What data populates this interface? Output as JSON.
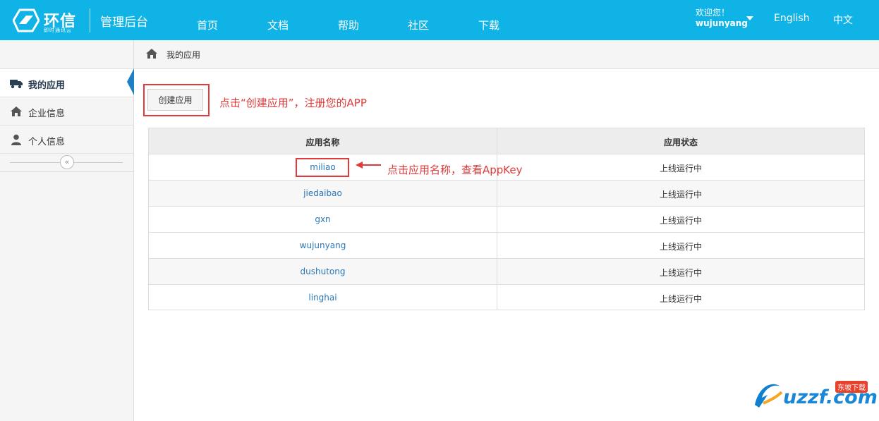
{
  "brand": {
    "name": "环信",
    "sub": "即时通讯云",
    "admin_title": "管理后台"
  },
  "nav": [
    {
      "label": "首页"
    },
    {
      "label": "文档"
    },
    {
      "label": "帮助"
    },
    {
      "label": "社区"
    },
    {
      "label": "下载"
    }
  ],
  "user": {
    "greeting": "欢迎您！",
    "name": "wujunyang"
  },
  "lang": {
    "english": "English",
    "chinese": "中文"
  },
  "breadcrumb": {
    "current": "我的应用"
  },
  "sidebar": {
    "items": [
      {
        "label": "我的应用",
        "icon": "truck-icon"
      },
      {
        "label": "企业信息",
        "icon": "home-icon"
      },
      {
        "label": "个人信息",
        "icon": "user-icon"
      }
    ],
    "collapse_glyph": "«"
  },
  "create_button": {
    "label": "创建应用"
  },
  "annotations": {
    "create": "点击“创建应用”，注册您的APP",
    "name": "点击应用名称，查看AppKey"
  },
  "table": {
    "headers": {
      "name": "应用名称",
      "status": "应用状态"
    },
    "rows": [
      {
        "name": "miliao",
        "status": "上线运行中"
      },
      {
        "name": "jiedaibao",
        "status": "上线运行中"
      },
      {
        "name": "gxn",
        "status": "上线运行中"
      },
      {
        "name": "wujunyang",
        "status": "上线运行中"
      },
      {
        "name": "dushutong",
        "status": "上线运行中"
      },
      {
        "name": "linghai",
        "status": "上线运行中"
      }
    ]
  },
  "watermark": {
    "text": "uzzf.com",
    "tag": "东坡下载"
  },
  "colors": {
    "brand_blue": "#0fb3e6",
    "annotation_red": "#e03a3a",
    "link_blue": "#2a78b8",
    "active_marker": "#1d7fc4"
  }
}
